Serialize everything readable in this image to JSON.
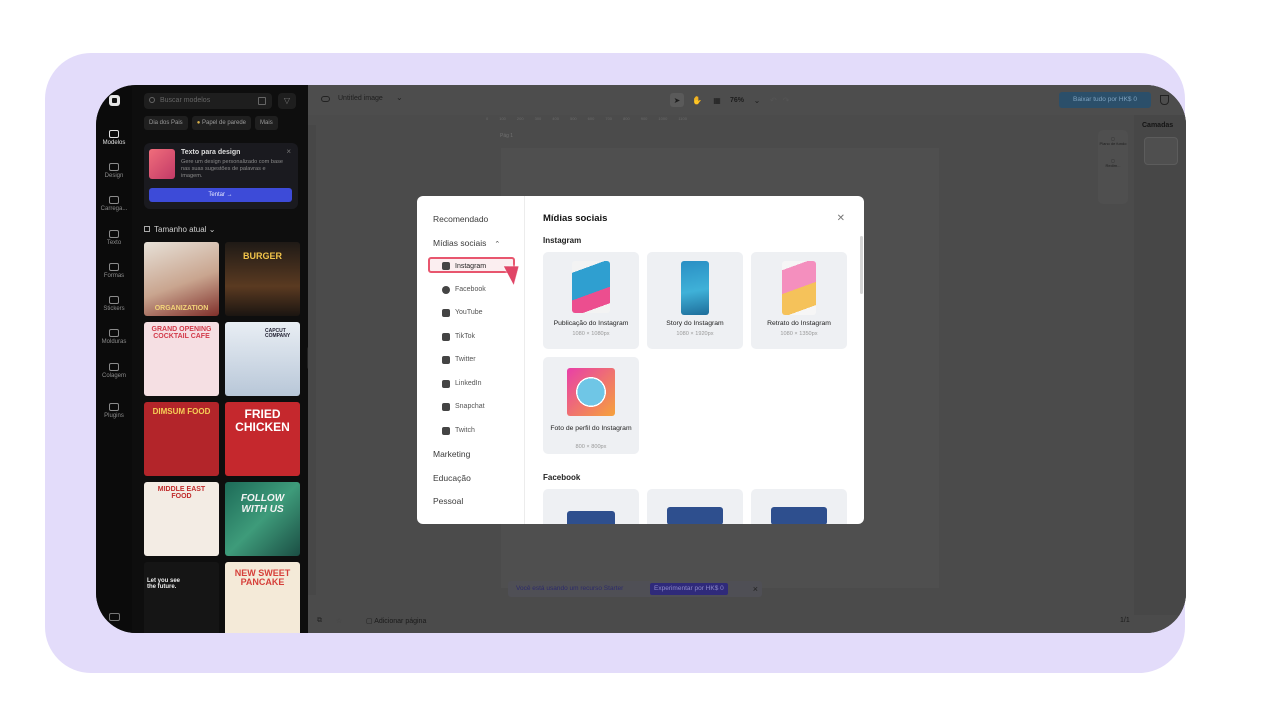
{
  "app": {
    "doc_title": "Untitled image",
    "zoom": "76%",
    "export_label": "Baixar tudo por HK$ 0",
    "layers_title": "Camadas",
    "page_label": "Pág 1",
    "add_page": "Adicionar página",
    "pager": "1/1"
  },
  "rail": [
    "Modelos",
    "Design",
    "Carrega...",
    "Texto",
    "Formas",
    "Stickers",
    "Molduras",
    "Colagem",
    "Plugins"
  ],
  "panel": {
    "search_placeholder": "Buscar modelos",
    "chips": [
      "Dia dos Pais",
      "Papel de parede",
      "Mais"
    ],
    "promo": {
      "title": "Texto para design",
      "desc": "Gere um design personalizado com base nas suas sugestões de palavras e imagem.",
      "button": "Tentar →"
    },
    "size_label": "Tamanho atual",
    "templates": [
      "ORGANIZATION",
      "BURGER",
      "GRAND OPENING COCKTAIL CAFE",
      "CAPCUT COMPANY",
      "DIMSUM FOOD",
      "FRIED CHICKEN",
      "MIDDLE EAST FOOD",
      "FOLLOW WITH US",
      "Let you see the future.",
      "NEW SWEET PANCAKE"
    ]
  },
  "float_tools": [
    "Plano de fundo",
    "Redim..."
  ],
  "starter": {
    "text": "Você está usando um recurso Starter",
    "button": "Experimentar por HK$ 0"
  },
  "modal": {
    "sidebar": {
      "recommended": "Recomendado",
      "social": "Mídias sociais",
      "items": [
        "Instagram",
        "Facebook",
        "YouTube",
        "TikTok",
        "Twitter",
        "LinkedIn",
        "Snapchat",
        "Twitch"
      ],
      "marketing": "Marketing",
      "education": "Educação",
      "personal": "Pessoal"
    },
    "title": "Mídias sociais",
    "instagram_label": "Instagram",
    "facebook_label": "Facebook",
    "cards": [
      {
        "name": "Publicação do Instagram",
        "dim": "1080 × 1080px"
      },
      {
        "name": "Story do Instagram",
        "dim": "1080 × 1920px"
      },
      {
        "name": "Retrato do Instagram",
        "dim": "1080 × 1350px"
      },
      {
        "name": "Foto de perfil do Instagram",
        "dim": "800 × 800px"
      }
    ]
  }
}
